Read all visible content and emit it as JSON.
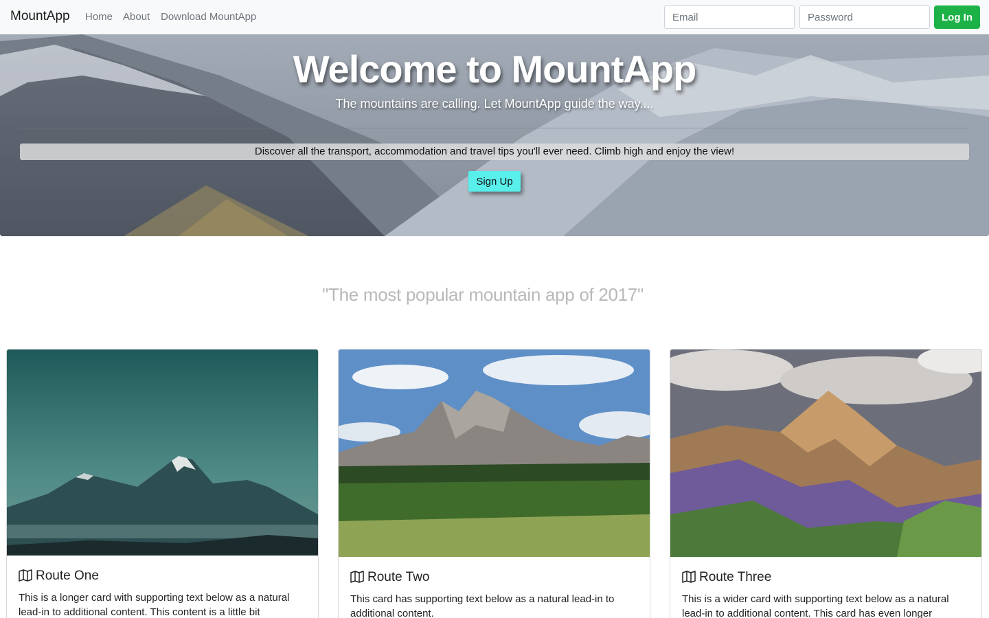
{
  "navbar": {
    "brand": "MountApp",
    "links": [
      "Home",
      "About",
      "Download MountApp"
    ],
    "email_placeholder": "Email",
    "password_placeholder": "Password",
    "login_label": "Log In",
    "login_color": "#1cb247"
  },
  "hero": {
    "title": "Welcome to MountApp",
    "subtitle": "The mountains are calling. Let MountApp guide the way....",
    "strip_text": "Discover all the transport, accommodation and travel tips you'll ever need. Climb high and enjoy the view!",
    "signup_label": "Sign Up",
    "signup_color": "#59f0ec"
  },
  "quote": "\"The most popular mountain app of 2017\"",
  "cards": [
    {
      "title": "Route One",
      "icon": "map-icon",
      "text": "This is a longer card with supporting text below as a natural lead-in to additional content. This content is a little bit"
    },
    {
      "title": "Route Two",
      "icon": "map-icon",
      "text": "This card has supporting text below as a natural lead-in to additional content."
    },
    {
      "title": "Route Three",
      "icon": "map-icon",
      "text": "This is a wider card with supporting text below as a natural lead-in to additional content. This card has even longer"
    }
  ]
}
